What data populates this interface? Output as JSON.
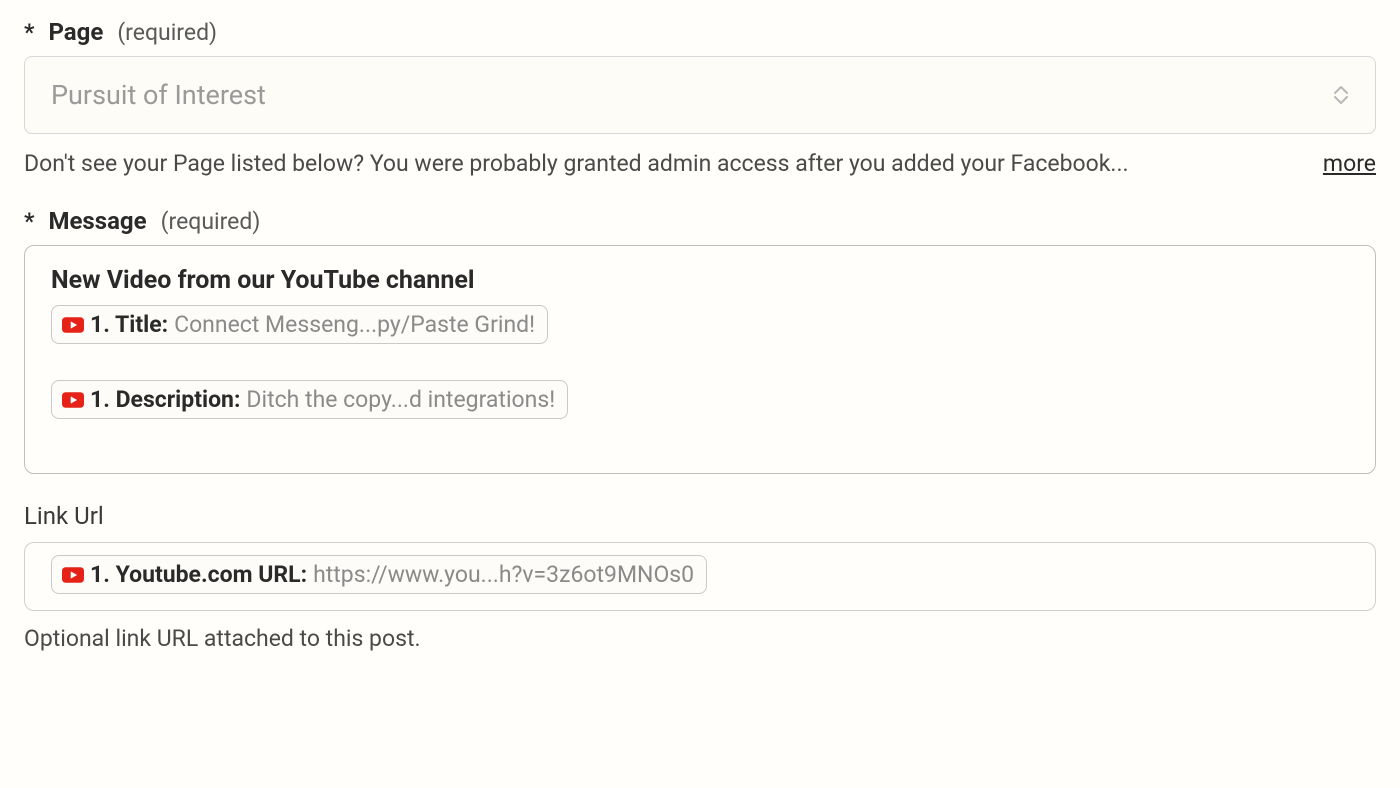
{
  "page_field": {
    "label": "Page",
    "required_text": "(required)",
    "asterisk": "*",
    "selected_value": "Pursuit of Interest",
    "help_text": "Don't see your Page listed below? You were probably granted admin access after you added your Facebook...",
    "more_label": "more"
  },
  "message_field": {
    "label": "Message",
    "required_text": "(required)",
    "asterisk": "*",
    "intro_text": "New Video from our YouTube channel",
    "token1": {
      "label": "1. Title:",
      "value": "Connect Messeng...py/Paste Grind!"
    },
    "token2": {
      "label": "1. Description:",
      "value": "Ditch the copy...d integrations!"
    }
  },
  "linkurl_field": {
    "label": "Link Url",
    "token": {
      "label": "1. Youtube.com URL:",
      "value": "https://www.you...h?v=3z6ot9MNOs0"
    },
    "description": "Optional link URL attached to this post."
  }
}
